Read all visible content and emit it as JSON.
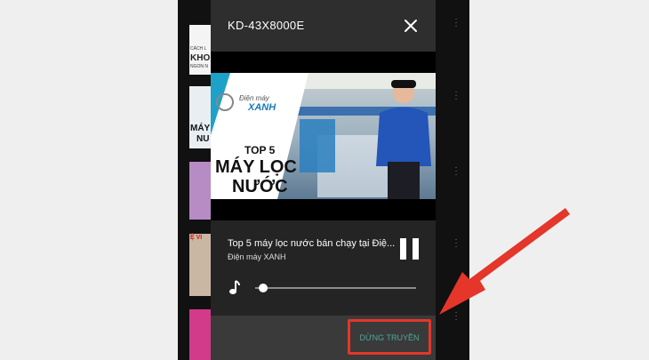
{
  "dialog": {
    "title": "KD-43X8000E",
    "close_icon": "close-icon",
    "video": {
      "brand_line1": "Điện máy",
      "brand_line2": "XANH",
      "headline_top": "TOP 5",
      "headline_line1": "MÁY LỌC",
      "headline_line2": "NƯỚC"
    },
    "track": {
      "title": "Top 5 máy lọc nước bán chạy tại Điệ...",
      "channel": "Điện máy XANH"
    },
    "controls": {
      "pause_icon": "pause-icon",
      "volume_icon": "music-note-icon",
      "volume_level": 0.05
    },
    "footer": {
      "stop_label": "DỪNG TRUYỀN"
    }
  },
  "background": {
    "thumb_texts": [
      "CÁCH L",
      "KHO",
      "NGON N",
      "MÁY",
      "NU",
      "MÁY",
      "NU",
      "Ệ VI"
    ]
  },
  "colors": {
    "dialog_bg": "#242424",
    "accent_text": "#4fa89a",
    "highlight": "#e4362a"
  }
}
